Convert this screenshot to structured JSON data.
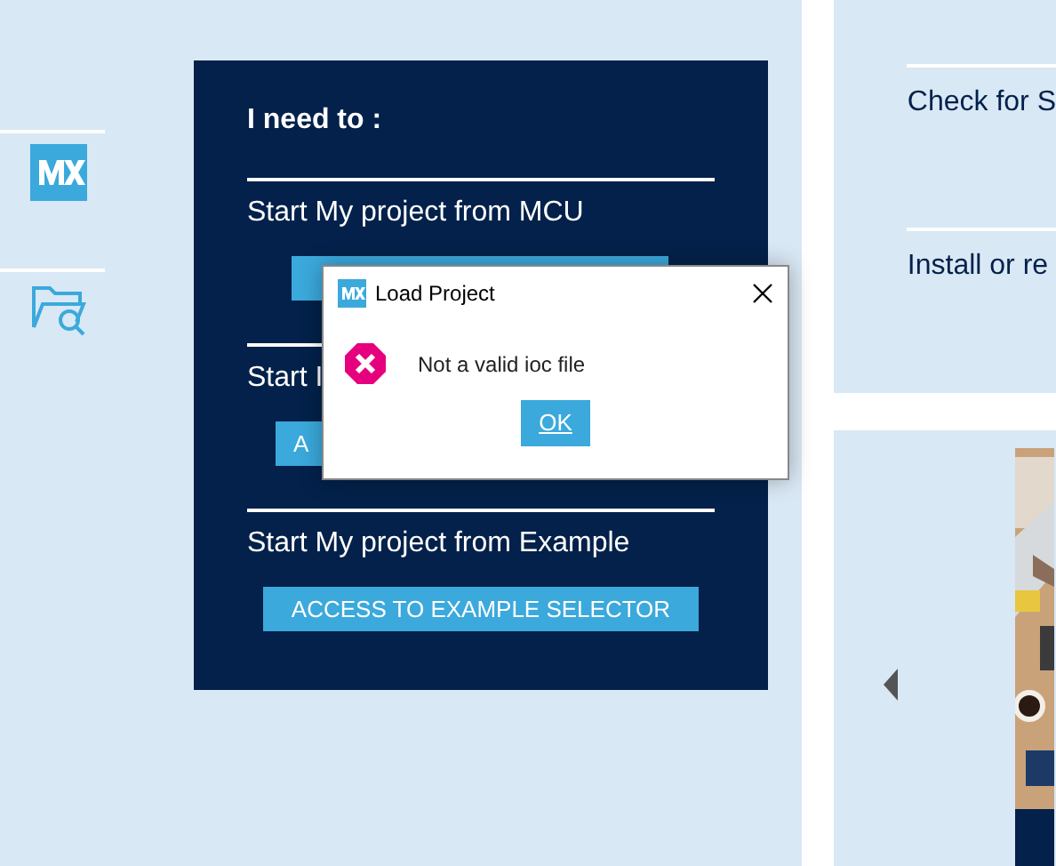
{
  "sidebar": {
    "items": [
      {
        "kind": "mx"
      },
      {
        "kind": "folder"
      }
    ]
  },
  "panel": {
    "heading": "I need to :",
    "sections": [
      {
        "title": "Start My project from MCU",
        "button": {
          "kind": "action"
        }
      },
      {
        "title": "Start I",
        "button": {
          "kind": "action",
          "label": "A"
        }
      },
      {
        "title": "Start My project from Example",
        "button": {
          "kind": "action",
          "label": "ACCESS TO EXAMPLE SELECTOR"
        }
      }
    ]
  },
  "right_panel": {
    "items": [
      "Check for S",
      "Install or re"
    ]
  },
  "dialog": {
    "title": "Load Project",
    "message": "Not a valid ioc file",
    "button": "OK"
  }
}
